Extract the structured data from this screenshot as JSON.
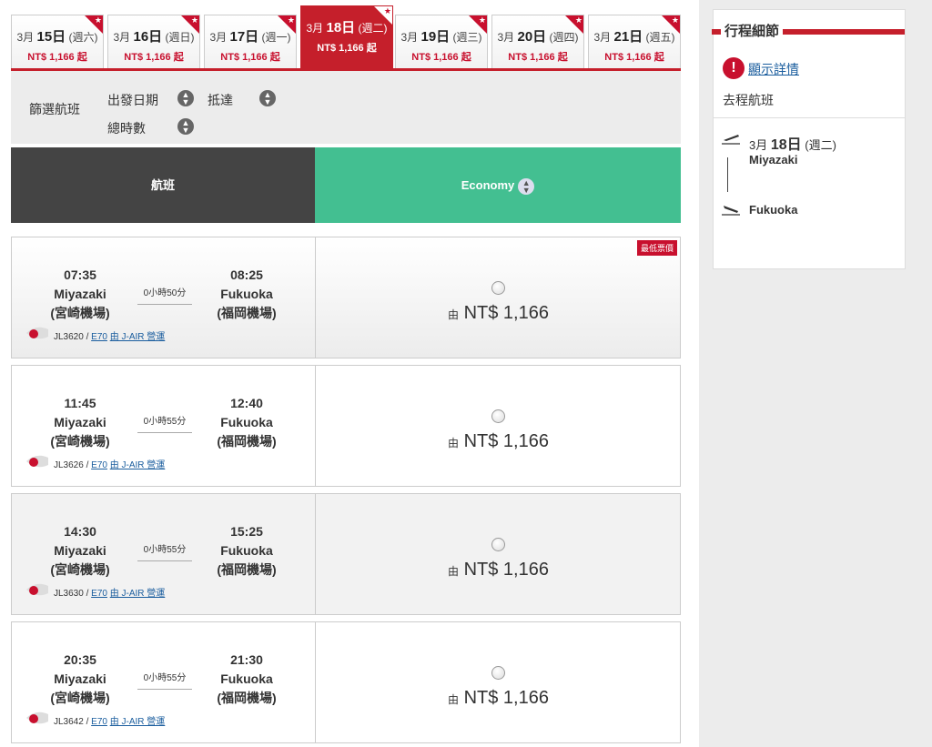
{
  "date_tabs": [
    {
      "month": "3月",
      "day": "15日",
      "weekday": "(週六)",
      "price": "NT$ 1,166 起"
    },
    {
      "month": "3月",
      "day": "16日",
      "weekday": "(週日)",
      "price": "NT$ 1,166 起"
    },
    {
      "month": "3月",
      "day": "17日",
      "weekday": "(週一)",
      "price": "NT$ 1,166 起"
    },
    {
      "month": "3月",
      "day": "18日",
      "weekday": "(週二)",
      "price": "NT$ 1,166 起",
      "active": true
    },
    {
      "month": "3月",
      "day": "19日",
      "weekday": "(週三)",
      "price": "NT$ 1,166 起"
    },
    {
      "month": "3月",
      "day": "20日",
      "weekday": "(週四)",
      "price": "NT$ 1,166 起"
    },
    {
      "month": "3月",
      "day": "21日",
      "weekday": "(週五)",
      "price": "NT$ 1,166 起"
    }
  ],
  "filter": {
    "title": "篩選航班",
    "departure_date": "出發日期",
    "arrival": "抵達",
    "total_duration": "總時數"
  },
  "table_header": {
    "flight": "航班",
    "cabin": "Economy"
  },
  "flights": [
    {
      "dep_time": "07:35",
      "dep_city": "Miyazaki",
      "dep_airport": "(宮崎機場)",
      "duration": "0小時50分",
      "arr_time": "08:25",
      "arr_city": "Fukuoka",
      "arr_airport": "(福岡機場)",
      "flight_no": "JL3620 / ",
      "aircraft": "E70",
      "operator": "由 J-AIR 營運",
      "fare_prefix": "由",
      "fare": "NT$ 1,166",
      "badge": "最低票價"
    },
    {
      "dep_time": "11:45",
      "dep_city": "Miyazaki",
      "dep_airport": "(宮崎機場)",
      "duration": "0小時55分",
      "arr_time": "12:40",
      "arr_city": "Fukuoka",
      "arr_airport": "(福岡機場)",
      "flight_no": "JL3626 / ",
      "aircraft": "E70",
      "operator": "由 J-AIR 營運",
      "fare_prefix": "由",
      "fare": "NT$ 1,166"
    },
    {
      "dep_time": "14:30",
      "dep_city": "Miyazaki",
      "dep_airport": "(宮崎機場)",
      "duration": "0小時55分",
      "arr_time": "15:25",
      "arr_city": "Fukuoka",
      "arr_airport": "(福岡機場)",
      "flight_no": "JL3630 / ",
      "aircraft": "E70",
      "operator": "由 J-AIR 營運",
      "fare_prefix": "由",
      "fare": "NT$ 1,166"
    },
    {
      "dep_time": "20:35",
      "dep_city": "Miyazaki",
      "dep_airport": "(宮崎機場)",
      "duration": "0小時55分",
      "arr_time": "21:30",
      "arr_city": "Fukuoka",
      "arr_airport": "(福岡機場)",
      "flight_no": "JL3642 / ",
      "aircraft": "E70",
      "operator": "由 J-AIR 營運",
      "fare_prefix": "由",
      "fare": "NT$ 1,166"
    }
  ],
  "sidebar": {
    "title": "行程細節",
    "show_details": "顯示詳情",
    "outbound_label": "去程航班",
    "month": "3月",
    "day": "18日",
    "weekday": "(週二)",
    "from": "Miyazaki",
    "to": "Fukuoka"
  },
  "colors": {
    "brand_red": "#c51f2b",
    "economy_green": "#43bf91",
    "header_dark": "#444444",
    "link_blue": "#1a5d9e"
  }
}
